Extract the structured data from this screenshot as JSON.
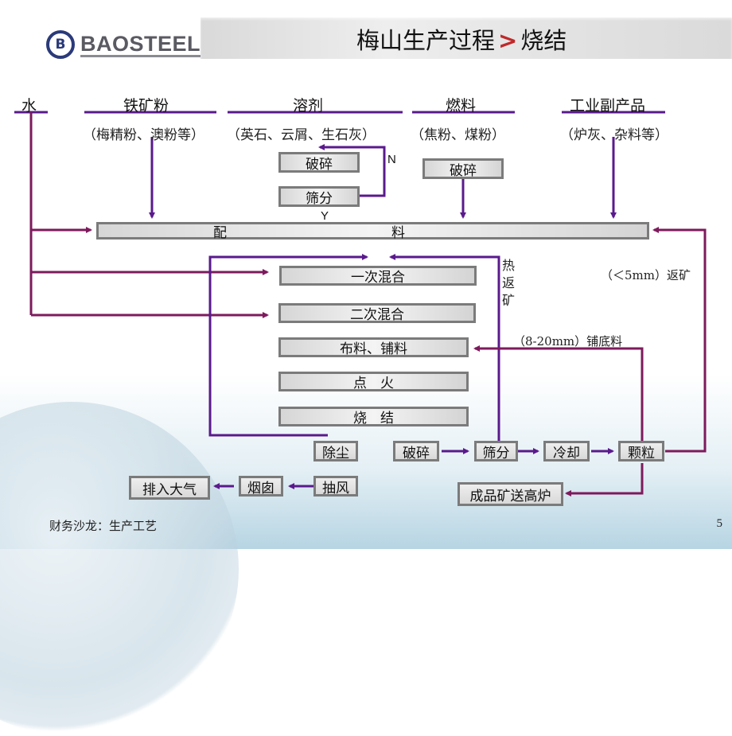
{
  "header": {
    "logo_text": "BAOSTEEL",
    "logo_mark": "B",
    "title_main": "梅山生产过程",
    "title_separator": ">",
    "title_sub": "烧结"
  },
  "inputs": [
    {
      "name": "水",
      "detail": ""
    },
    {
      "name": "铁矿粉",
      "detail": "（梅精粉、澳粉等）"
    },
    {
      "name": "溶剂",
      "detail": "（英石、云屑、生石灰）"
    },
    {
      "name": "燃料",
      "detail": "（焦粉、煤粉）"
    },
    {
      "name": "工业副产品",
      "detail": "（炉灰、杂料等）"
    }
  ],
  "flux_branch": {
    "crush": "破碎",
    "screen": "筛分",
    "no_label": "N",
    "yes_label": "Y"
  },
  "fuel_branch": {
    "crush": "破碎"
  },
  "batching": {
    "left": "配",
    "right": "料"
  },
  "main_steps": [
    "一次混合",
    "二次混合",
    "布料、铺料",
    "点　火",
    "烧　结"
  ],
  "return_labels": {
    "hot_return": [
      "热",
      "返",
      "矿"
    ],
    "fine_return": "（＜5mm）返矿",
    "hearth_layer": "（8-20mm）铺底料"
  },
  "post_steps": {
    "dust": "除尘",
    "crush": "破碎",
    "screen": "筛分",
    "cool": "冷却",
    "pellet": "颗粒",
    "product": "成品矿送高炉"
  },
  "exhaust": {
    "fan": "抽风",
    "chimney": "烟囱",
    "atmosphere": "排入大气"
  },
  "colors": {
    "flow_purple": "#5a1a8c",
    "return_magenta": "#7e1a5c",
    "box_border": "#7b7b7b",
    "title_separator": "#c0292a"
  },
  "footer": {
    "text": "财务沙龙：生产工艺",
    "page": "5"
  }
}
